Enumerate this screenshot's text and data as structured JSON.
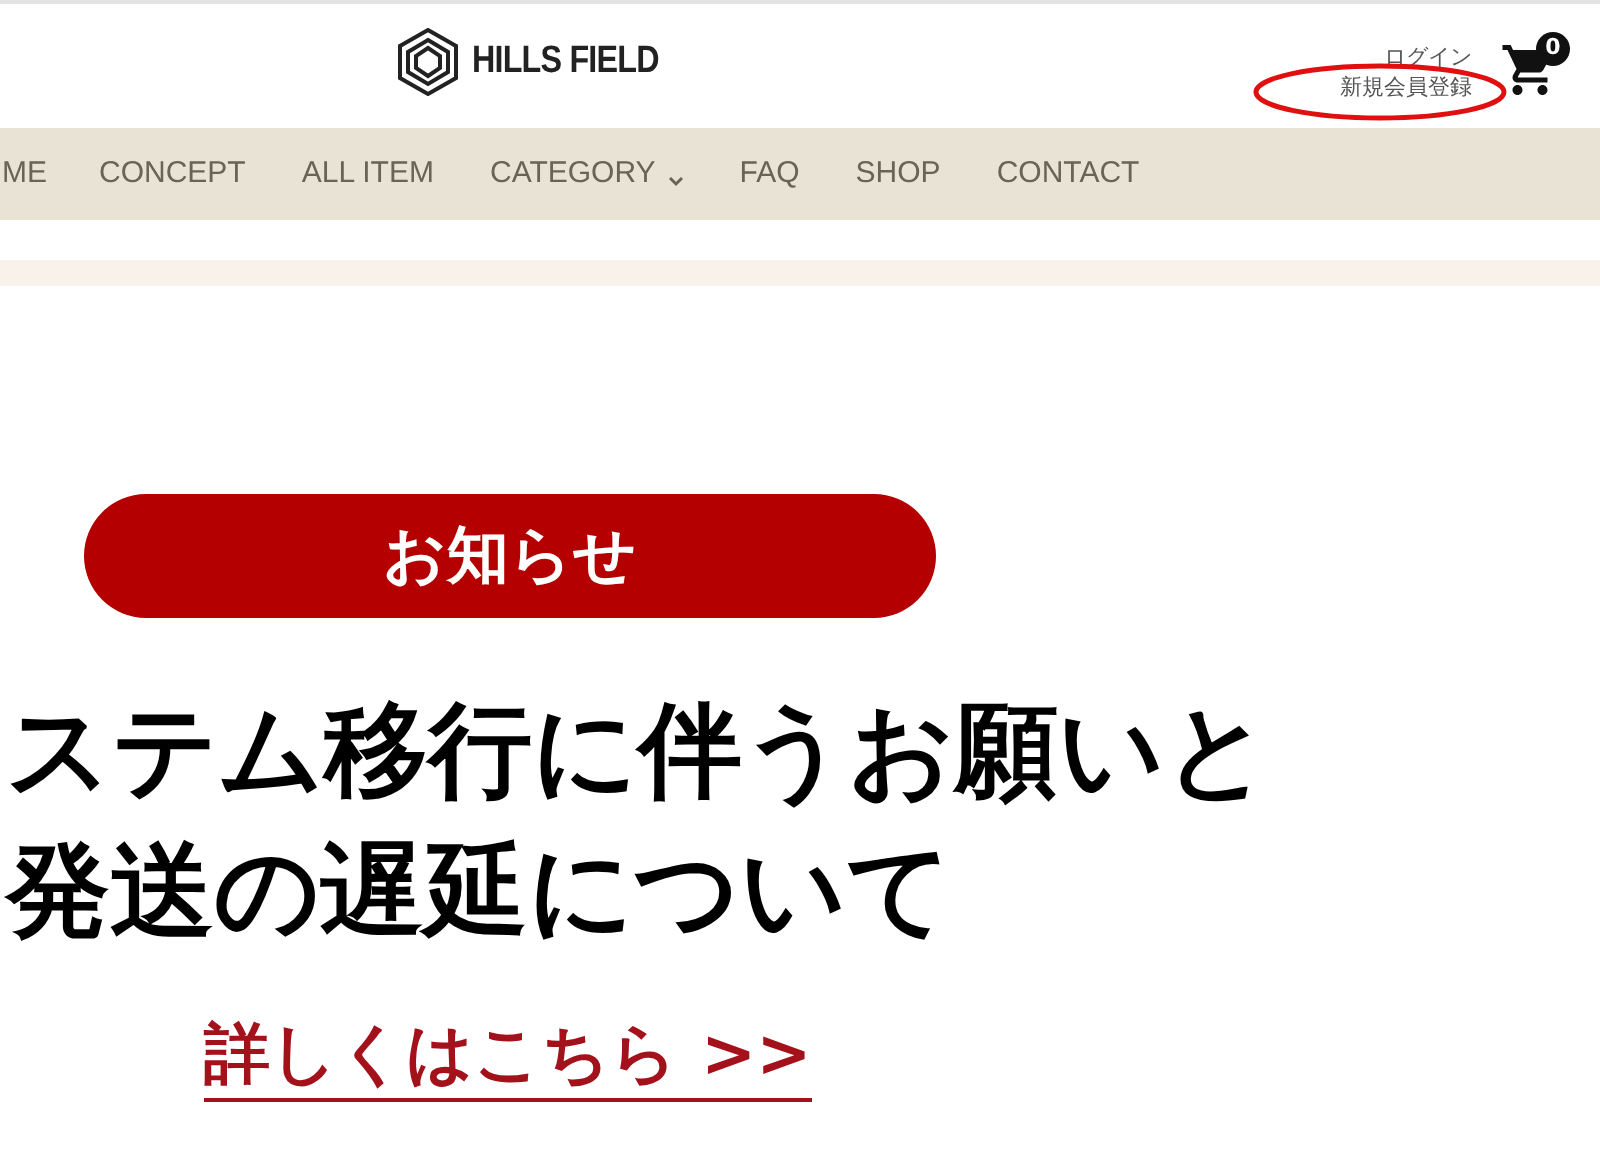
{
  "header": {
    "logo_text": "HILLS FIELD",
    "login_link": "ログイン",
    "register_link": "新規会員登録",
    "cart_count": "0"
  },
  "nav": [
    {
      "label": "ME",
      "kind": "link"
    },
    {
      "label": "CONCEPT",
      "kind": "link"
    },
    {
      "label": "ALL ITEM",
      "kind": "link"
    },
    {
      "label": "CATEGORY",
      "kind": "dropdown"
    },
    {
      "label": "FAQ",
      "kind": "link"
    },
    {
      "label": "SHOP",
      "kind": "link"
    },
    {
      "label": "CONTACT",
      "kind": "link"
    }
  ],
  "notice": {
    "badge": "お知らせ",
    "headline": [
      "ステム移行に伴うお願いと",
      "発送の遅延について"
    ],
    "link": "詳しくはこちら >>"
  }
}
